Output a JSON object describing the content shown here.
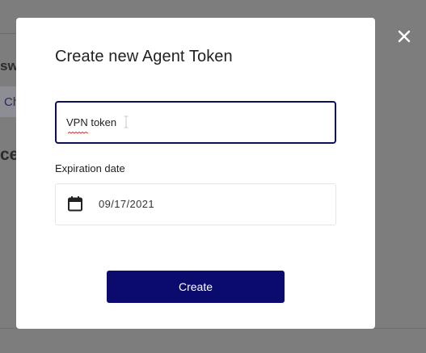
{
  "background": {
    "fragment_1": "sw",
    "chip_label": "Ch",
    "fragment_2": "ce"
  },
  "modal": {
    "title": "Create new Agent Token",
    "name_field": {
      "value": "VPN token"
    },
    "expiration": {
      "label": "Expiration date",
      "value": "09/17/2021"
    },
    "create_label": "Create"
  },
  "icons": {
    "close": "close-icon",
    "calendar": "calendar-icon"
  },
  "colors": {
    "overlay": "#7d7d7d",
    "accent": "#0b0b6e",
    "field_border": "#0f0f55"
  }
}
